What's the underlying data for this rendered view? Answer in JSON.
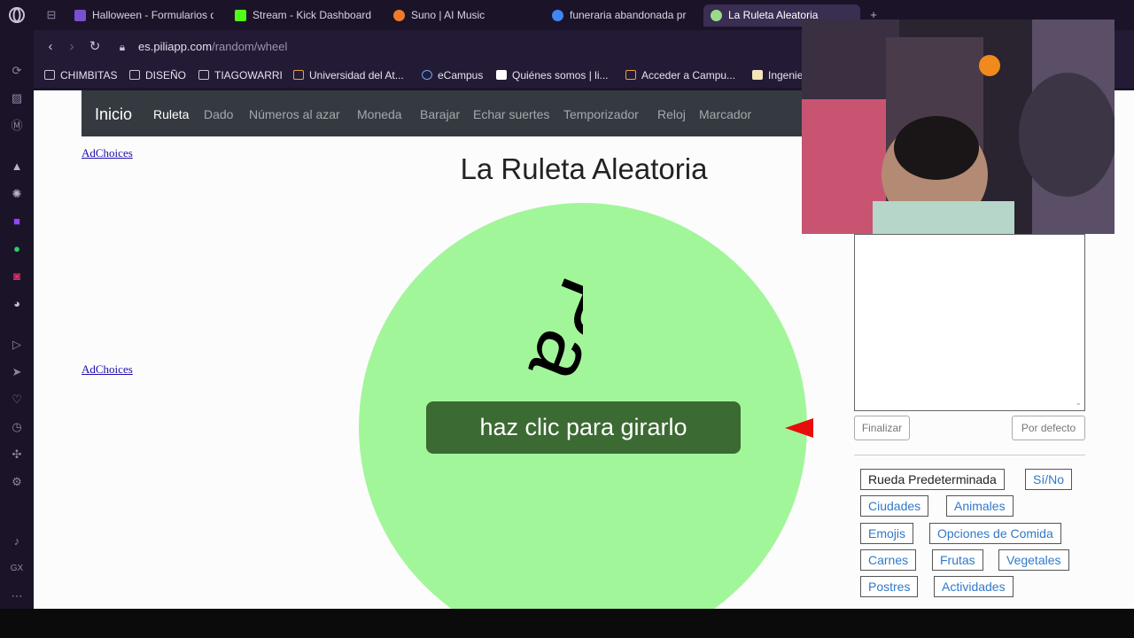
{
  "browser": {
    "tabs": [
      {
        "title": "Halloween - Formularios d",
        "color": "#7b4fd0"
      },
      {
        "title": "Stream - Kick Dashboard",
        "color": "#53fc18"
      },
      {
        "title": "Suno | AI Music",
        "color": "#f07a2a"
      },
      {
        "title": "funeraria abandonada pr",
        "color": "#4285f4"
      },
      {
        "title": "La Ruleta Aleatoria",
        "color": "#9adb8a"
      }
    ],
    "url_host": "es.piliapp.com",
    "url_path": "/random/wheel",
    "bookmarks": [
      "CHIMBITAS",
      "DISEÑO",
      "TIAGOWARRI",
      "Universidad del At...",
      "eCampus",
      "Quiénes somos | li...",
      "Acceder a Campu...",
      "Ingenie"
    ]
  },
  "site": {
    "brand": "Inicio",
    "nav": [
      "Ruleta",
      "Dado",
      "Números al azar",
      "Moneda",
      "Barajar",
      "Echar suertes",
      "Temporizador",
      "Reloj",
      "Marcador"
    ],
    "active_nav": "Ruleta",
    "adchoices": "AdChoices",
    "title": "La Ruleta Aleatoria",
    "wheel": {
      "color": "#a2f69a",
      "segment_text": "Pa",
      "spin_label": "haz clic para girarlo"
    },
    "buttons": {
      "finish": "Finalizar",
      "default": "Por defecto"
    },
    "presets": [
      "Rueda Predeterminada",
      "Sí/No",
      "Ciudades",
      "Animales",
      "Emojis",
      "Opciones de Comida",
      "Carnes",
      "Frutas",
      "Vegetales",
      "Postres",
      "Actividades"
    ]
  }
}
